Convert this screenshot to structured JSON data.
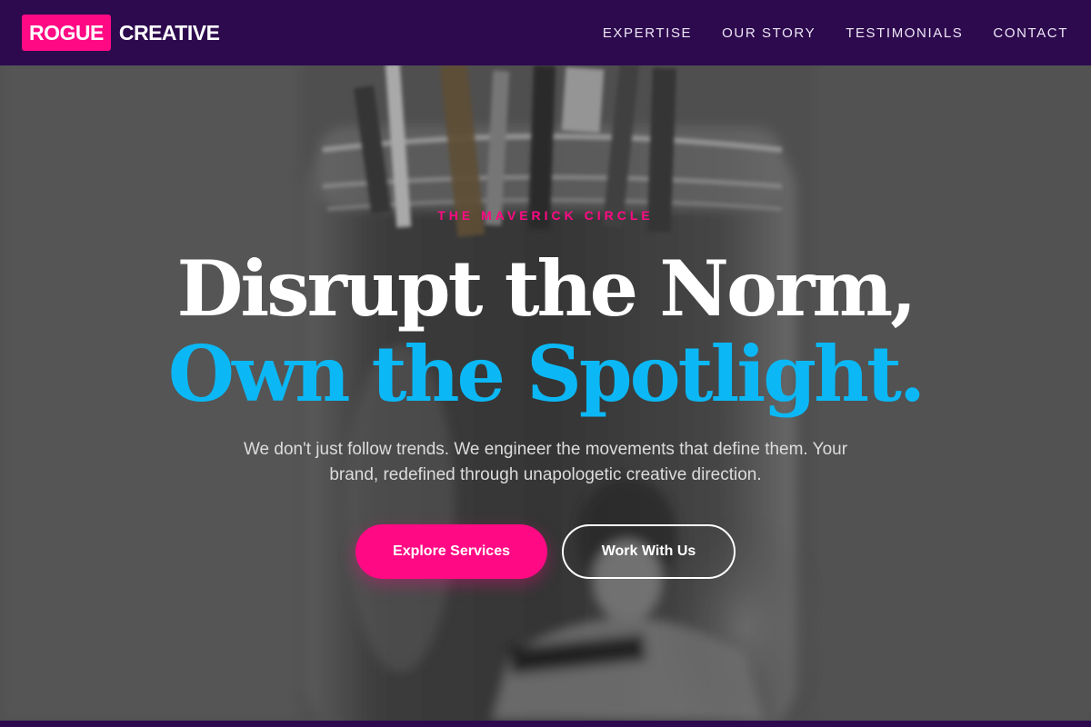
{
  "brand": {
    "badge": "ROGUE",
    "word": "CREATIVE",
    "accent_color": "#ff0a84",
    "nav_color": "#2d0a4e"
  },
  "nav": {
    "links": [
      {
        "label": "EXPERTISE"
      },
      {
        "label": "OUR STORY"
      },
      {
        "label": "TESTIMONIALS"
      },
      {
        "label": "CONTACT"
      }
    ]
  },
  "hero": {
    "eyebrow": "THE MAVERICK CIRCLE",
    "headline_line1": "Disrupt the Norm,",
    "headline_line2": "Own the Spotlight.",
    "headline_accent_color": "#0bb8f5",
    "subtext": "We don't just follow trends. We engineer the movements that define them. Your brand, redefined through unapologetic creative direction.",
    "primary_cta": "Explore Services",
    "secondary_cta": "Work With Us",
    "background": "grayscale-photo-brushes-in-jar"
  }
}
